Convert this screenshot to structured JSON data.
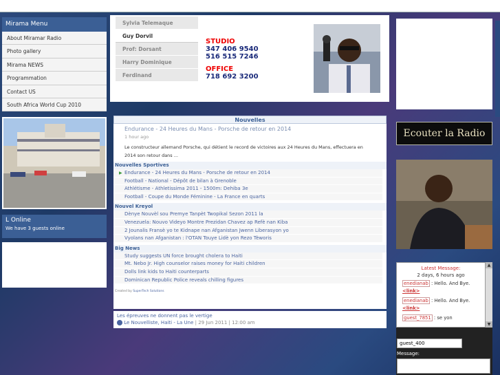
{
  "menu": {
    "title": "Mirama Menu",
    "items": [
      "About Miramar Radio",
      "Photo gallery",
      "Mirama NEWS",
      "Programmation",
      "Contact US",
      "South Africa World Cup 2010"
    ]
  },
  "online": {
    "title": "L Online",
    "status": "We have 3 guests online"
  },
  "header": {
    "djs": [
      "Sylvia Telemaque",
      "Guy Dorvil",
      "Prof: Dorsant",
      "Harry Dominique",
      "Ferdinand"
    ],
    "active_dj": "Guy Dorvil",
    "studio_label": "STUDIO",
    "studio_phone_1": "347 406 9540",
    "studio_phone_2": "516 515 7246",
    "office_label": "OFFICE",
    "office_phone": "718 692 3200"
  },
  "news": {
    "title": "Nouvelles",
    "lead": {
      "title": "Endurance - 24 Heures du Mans - Porsche de retour en 2014",
      "time": "1 hour ago",
      "body": "Le constructeur allemand Porsche, qui détient le record de victoires aux 24 Heures du Mans, effectuera en 2014 son retour dans ..."
    },
    "sections": [
      {
        "title": "Nouvelles Sportives",
        "items": [
          "Endurance - 24 Heures du Mans - Porsche de retour en 2014",
          "Football - National - Dépôt de bilan à Grenoble",
          "Athlétisme - Athletissima 2011 - 1500m: Dehiba 3e",
          "Football - Coupe du Monde Féminine - La France en quarts"
        ]
      },
      {
        "title": "Nouvel Kreyol",
        "items": [
          "Dènye Nouvèl sou Premye Tanpèt Twopikal Sezon 2011 la",
          "Venezuela: Nouvo Videyo Montre Prezidan Chavez ap Refè nan Kiba",
          "2 Jounalis Fransè yo te Kidnape nan Afganistan Jwenn Liberasyon yo",
          "Vyolans nan Afganistan : l'OTAN Touye Lidè yon Rezo Tèworis"
        ]
      },
      {
        "title": "Big News",
        "items": [
          "Study suggests UN force brought cholera to Haiti",
          "Mt. Nebo Jr. High counselor raises money for Haiti children",
          "Dolls link kids to Haiti counterparts",
          "Dominican Republic Police reveals chilling figures"
        ]
      }
    ],
    "credit_prefix": "Created by ",
    "credit_link": "SuperTech Solutions"
  },
  "footer": {
    "headline": "Les épreuves ne donnent pas le vertige",
    "source": "Le Nouvelliste, Haiti - La Une",
    "date": " | 29 Jun 2011 | 12:00 am"
  },
  "radio_button": "Ecouter la Radio",
  "chat": {
    "latest_label": "Latest Message:",
    "latest_time": "2 days, 6 hours ago",
    "messages": [
      {
        "user": "enedianab",
        "text": " : Hello. And Bye. ",
        "link": "<link>"
      },
      {
        "user": "enedianab",
        "text": " : Hello. And Bye. ",
        "link": "<link>"
      },
      {
        "user": "guest_7851",
        "text": " : se yon",
        "link": ""
      }
    ],
    "username": "guest_400",
    "message_label": "Message:"
  },
  "colors": {
    "menu_blue": "#3b5f95",
    "link_blue": "#4a64a0",
    "red": "#e00000"
  }
}
